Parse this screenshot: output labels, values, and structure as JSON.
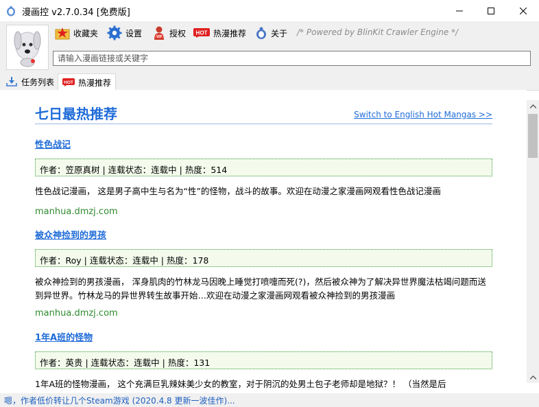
{
  "window": {
    "title": "漫画控 v2.7.0.34 [免费版]"
  },
  "toolbar": {
    "favorites": "收藏夹",
    "settings": "设置",
    "license": "授权",
    "hot": "热漫推荐",
    "about": "关于",
    "powered": "/* Powered by BlinKit Crawler Engine */"
  },
  "search": {
    "placeholder": "请输入漫画链接或关键字"
  },
  "tabs": {
    "tasks": "任务列表",
    "hot": "热漫推荐"
  },
  "content": {
    "heading": "七日最热推荐",
    "switch_link": "Switch to English Hot Mangas >>",
    "mangas": [
      {
        "title": "性色战记",
        "info": "作者：笠原真树 | 连载状态：连载中 | 热度：514",
        "desc": "性色战记漫画， 这是男子高中生与名为“性”的怪物，战斗的故事。欢迎在动漫之家漫画网观看性色战记漫画",
        "source": "manhua.dmzj.com"
      },
      {
        "title": "被众神捡到的男孩",
        "info": "作者：Roy | 连载状态：连载中 | 热度：178",
        "desc": "被众神捡到的男孩漫画， 浑身肌肉的竹林龙马因晚上睡觉打喷嚏而死(?)，然后被众神为了解决异世界魔法枯竭问题而送到异世界。竹林龙马的异世界转生故事开始…欢迎在动漫之家漫画网观看被众神捡到的男孩漫画",
        "source": "manhua.dmzj.com"
      },
      {
        "title": "1年A班的怪物",
        "info": "作者：英贵 | 连载状态：连载中 | 热度：131",
        "desc": "1年A班的怪物漫画， 这个充满巨乳辣妹美少女的教室，对于阴沉的处男土包子老师却是地狱？！ （当然是后",
        "source": ""
      }
    ]
  },
  "status": {
    "text": "嗯，作者低价转让几个Steam游戏 (2020.4.8 更新一波佳作)..."
  },
  "colors": {
    "accent": "#1e6bd8",
    "source_green": "#2f8a2f",
    "info_border": "#3a9a3a",
    "hot_badge": "#e02020"
  }
}
